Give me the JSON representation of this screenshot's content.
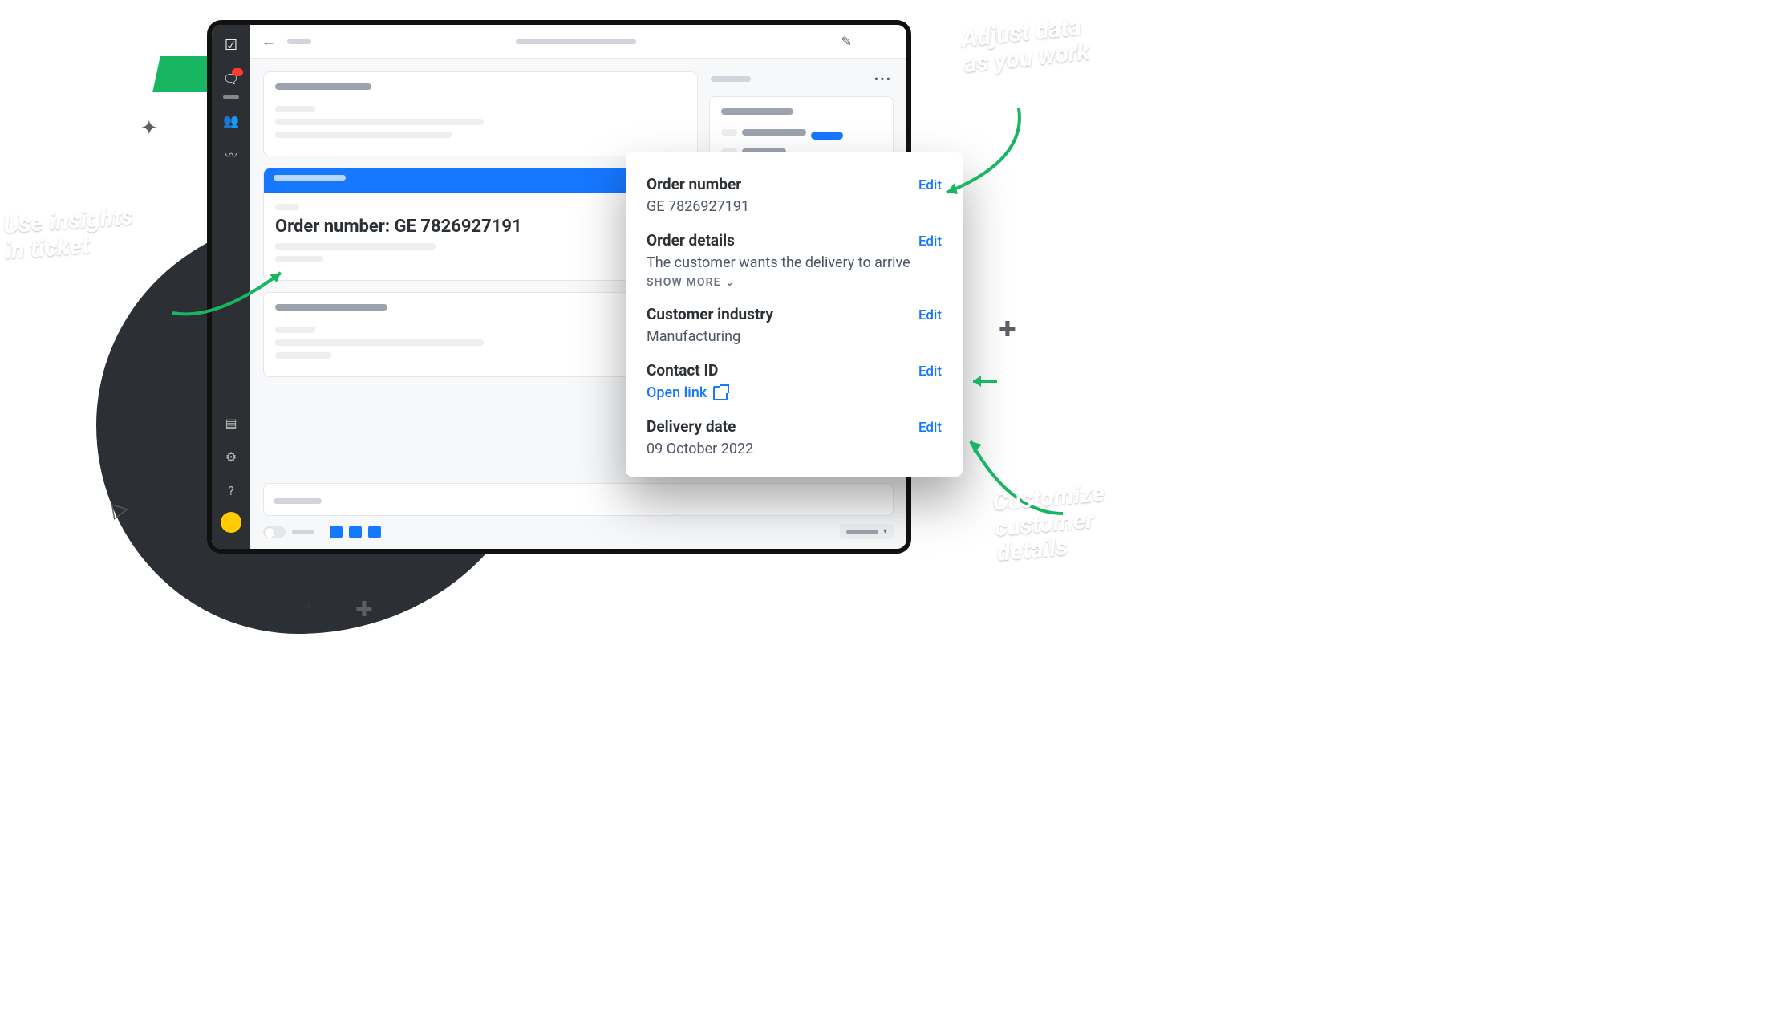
{
  "annotations": {
    "left": "Use insights\nin ticket",
    "top_right": "Adjust data\nas you work",
    "bottom_right": "Customize\ncustomer\ndetails"
  },
  "ticket": {
    "order_line": "Order number: GE 7826927191"
  },
  "details": {
    "fields": [
      {
        "label": "Order number",
        "value": "GE 7826927191",
        "edit": "Edit"
      },
      {
        "label": "Order details",
        "value": "The customer wants the delivery to arrive",
        "edit": "Edit",
        "show_more": "SHOW MORE"
      },
      {
        "label": "Customer industry",
        "value": "Manufacturing",
        "edit": "Edit"
      },
      {
        "label": "Contact ID",
        "link_text": "Open link",
        "edit": "Edit"
      },
      {
        "label": "Delivery date",
        "value": "09 October 2022",
        "edit": "Edit"
      }
    ]
  }
}
